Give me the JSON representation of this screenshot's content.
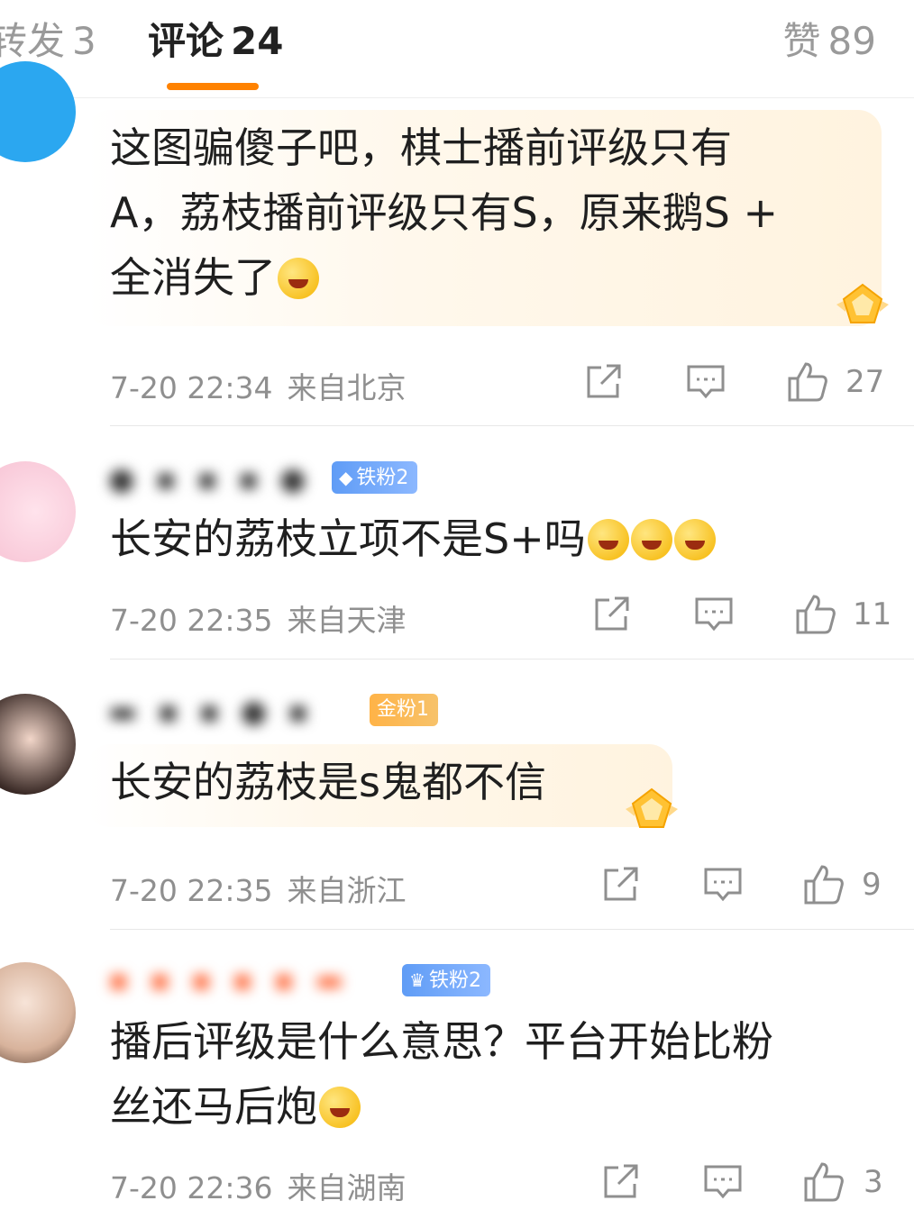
{
  "tabs": {
    "repost": {
      "label": "转发",
      "count": "3"
    },
    "comment": {
      "label": "评论",
      "count": "24"
    },
    "like": {
      "label": "赞",
      "count": "89"
    }
  },
  "comments": [
    {
      "text_lines": [
        "这图骗傻子吧，棋士播前评级只有",
        "A，荔枝播前评级只有S，原来鹅S +",
        "全消失了"
      ],
      "emoji": "laugh-cry-emoji",
      "time": "7-20 22:34",
      "location": "来自北京",
      "likes": "27"
    },
    {
      "badge": "铁粉2",
      "text": "长安的荔枝立项不是S+吗",
      "emoji": "drool-emoji",
      "time": "7-20 22:35",
      "location": "来自天津",
      "likes": "11"
    },
    {
      "badge": "金粉1",
      "text": "长安的荔枝是s鬼都不信",
      "time": "7-20 22:35",
      "location": "来自浙江",
      "likes": "9"
    },
    {
      "badge": "铁粉2",
      "text_lines": [
        "播后评级是什么意思？平台开始比粉",
        "丝还马后炮"
      ],
      "emoji": "laugh-cry-emoji",
      "time": "7-20 22:36",
      "location": "来自湖南",
      "likes": "3"
    }
  ],
  "colors": {
    "accent": "#ff8200",
    "badge_iron": "#5f9cf6",
    "badge_gold": "#ffb347",
    "meta_text": "#8f8f8f"
  }
}
